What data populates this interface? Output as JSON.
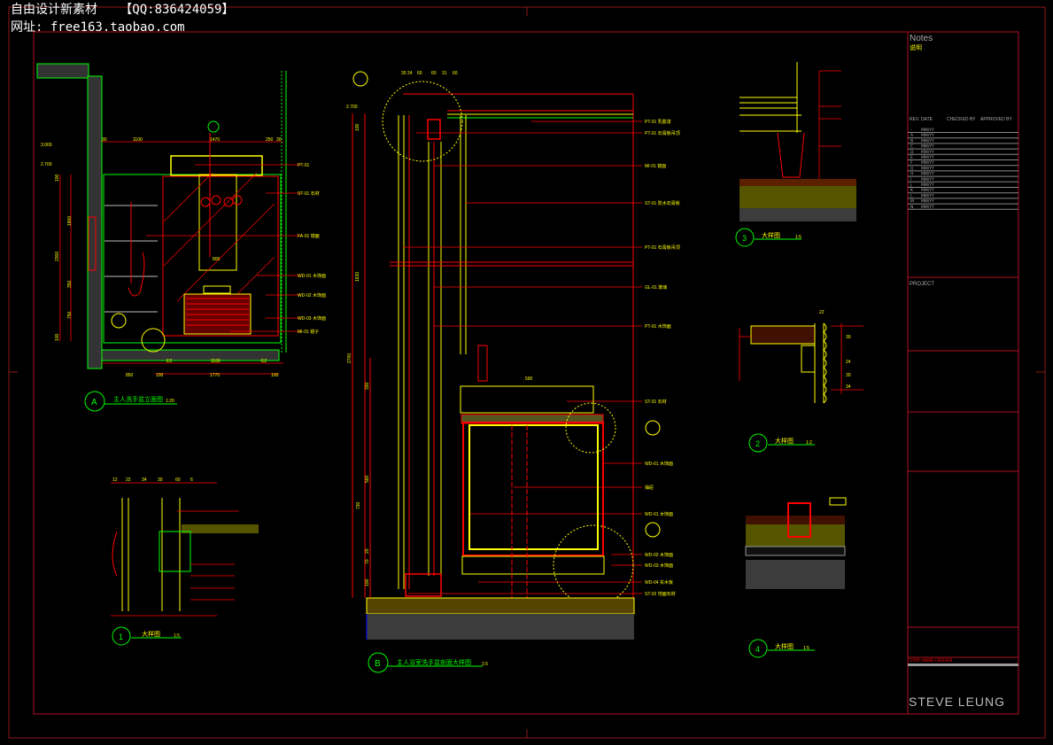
{
  "watermark": {
    "line1": "自由设计新素材   【QQ:836424059】",
    "line2": "网址: free163.taobao.com"
  },
  "title_block": {
    "notes_label": "Notes",
    "notes_cn": "说明",
    "rev_headers": [
      "REV.",
      "DATE",
      "CHECKED BY",
      "APPROVED BY"
    ],
    "rev_rows": [
      "-",
      "A",
      "B",
      "C",
      "D",
      "E",
      "F",
      "G",
      "H",
      "I",
      "J",
      "K",
      "L",
      "M",
      "N"
    ],
    "rev_date": "MM/YY",
    "project_label": "PROJECT",
    "scale_note": "CHIP NAME DESIGN",
    "firm": "STEVE LEUNG"
  },
  "drawings": {
    "A": {
      "tag": "A",
      "title": "主人洗手盆立面图",
      "scale": "1:20",
      "dims_top": [
        "30",
        "1100",
        "1470",
        "250",
        "30"
      ],
      "dims_bottom1": [
        "E2",
        "1160",
        "E2"
      ],
      "dims_bottom2": [
        "850",
        "100",
        "1770",
        "100"
      ],
      "dims_left": [
        "100",
        "1800",
        "2300",
        "350",
        "750",
        "100"
      ],
      "levels": [
        "3.000",
        "2.700"
      ],
      "label_800": "800"
    },
    "B": {
      "tag": "B",
      "title": "主人浴室洗手盆剖面大样图",
      "scale": "1:5",
      "dims_top": [
        "30",
        "24",
        "60",
        "60",
        "31",
        "60"
      ],
      "dims_left": [
        "100",
        "1630",
        "2700",
        "330",
        "560",
        "730",
        "20",
        "70",
        "100"
      ],
      "width_dim": "590",
      "level": "2.700"
    },
    "D1": {
      "tag": "3",
      "title": "大样图",
      "scale": "1:5"
    },
    "D2": {
      "tag": "2",
      "title": "大样图",
      "scale": "1:2",
      "dims": [
        "22",
        "30",
        "24",
        "30",
        "34"
      ]
    },
    "D3": {
      "tag": "4",
      "title": "大样图",
      "scale": "1:5"
    },
    "D4": {
      "tag": "1",
      "title": "大样图",
      "scale": "1:5",
      "dims": [
        "12",
        "22",
        "34",
        "30",
        "60",
        "6"
      ]
    }
  },
  "callouts": {
    "A": [
      "PT-01",
      "ST-01 石材",
      "FA-01 镜面",
      "WD-01 木饰面",
      "WD-02 木饰面",
      "WD-03 木饰面",
      "MI-01 镜子"
    ],
    "B": [
      "PT-01 乳胶漆",
      "PT-01 石膏板吊顶",
      "MI-01 镜面",
      "ST-01 防水石膏板",
      "PT-01 石膏板吊顶",
      "GL-01 玻璃",
      "PT-01 木饰面",
      "ST-01 石材",
      "WD-01 木饰面",
      "抽屉",
      "WD-01 木饰面",
      "WD-02 木饰面",
      "WD-03 木饰面",
      "WD-04 实木板",
      "ST-02 地面石材"
    ]
  },
  "colors": {
    "frame": "#c8102e",
    "line_red": "#ff0000",
    "line_yellow": "#ffff00",
    "line_green": "#00ff00",
    "text_gray": "#b0b0b0",
    "concrete": "#404040"
  }
}
